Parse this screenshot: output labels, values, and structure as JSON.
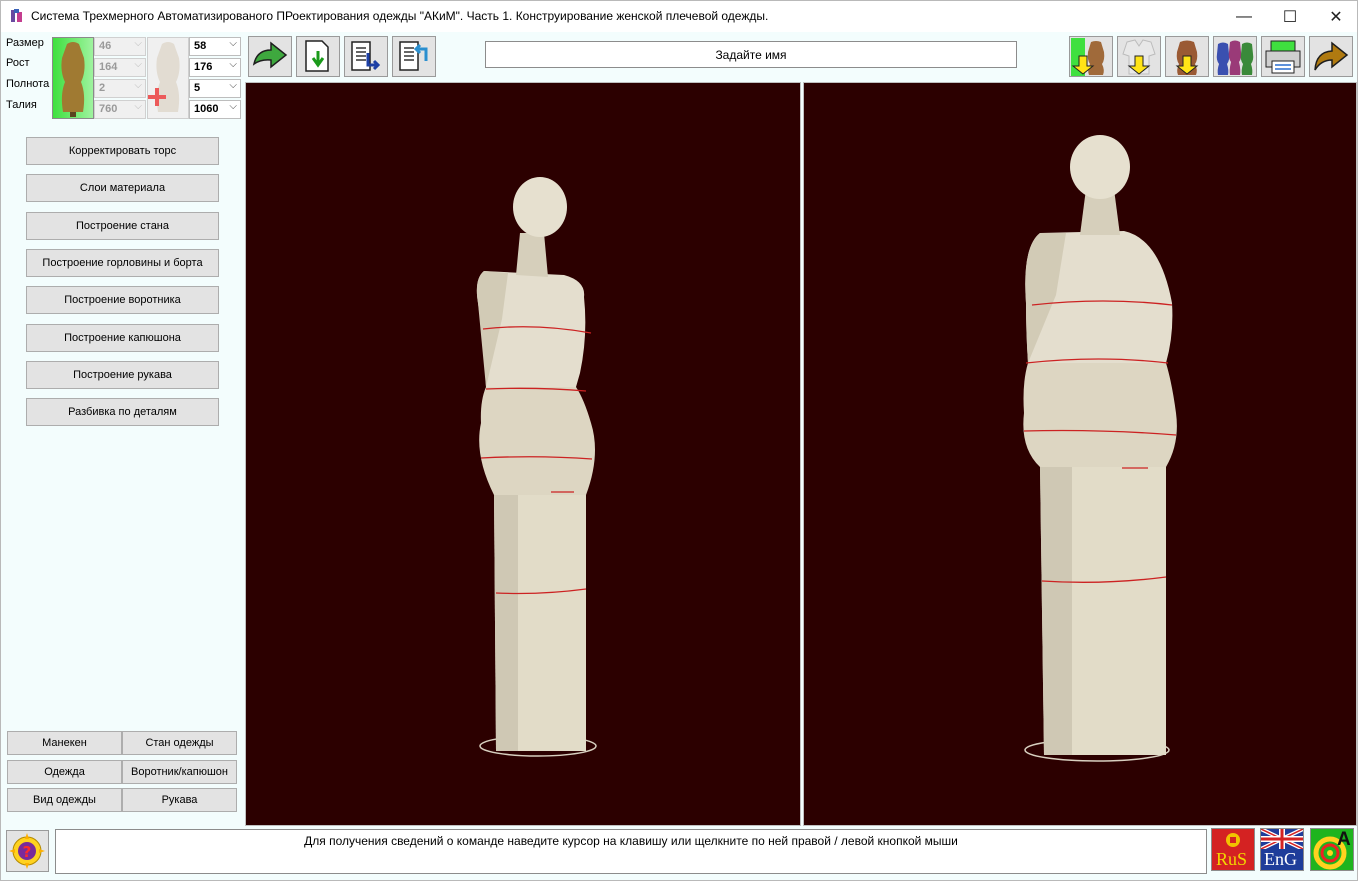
{
  "window": {
    "title": "Система  Трехмерного Автоматизированого ПРоектирования одежды  \"АКиМ\".  Часть 1.  Конструирование женской плечевой одежды.",
    "minimize_glyph": "—",
    "maximize_glyph": "☐",
    "close_glyph": "✕"
  },
  "params": {
    "labels": [
      "Размер",
      "Рост",
      "Полнота",
      "Талия"
    ],
    "base_values": [
      "46",
      "164",
      "2",
      "760"
    ],
    "target_values": [
      "58",
      "176",
      "5",
      "1060"
    ]
  },
  "left_menu": [
    "Корректировать торс",
    "Слои материала",
    "Построение стана",
    "Построение горловины и борта",
    "Построение воротника",
    "Построение капюшона",
    "Построение рукава",
    "Разбивка по деталям"
  ],
  "bottom_buttons": [
    "Манекен",
    "Стан одежды",
    "Одежда",
    "Воротник/капюшон",
    "Вид одежды",
    "Рукава"
  ],
  "name_field": "Задайте имя",
  "status_text": "Для получения сведений о команде наведите курсор на клавишу или щелкните по ней правой / левой кнопкой мыши",
  "lang": {
    "ru": "RuS",
    "en": "EnG",
    "logo_letter": "A"
  },
  "colors": {
    "viewport_bg": "#2c0000",
    "mannequin": "#e7e2d2",
    "measure_line": "#d21b1b",
    "accent_green": "#3fe03f"
  }
}
